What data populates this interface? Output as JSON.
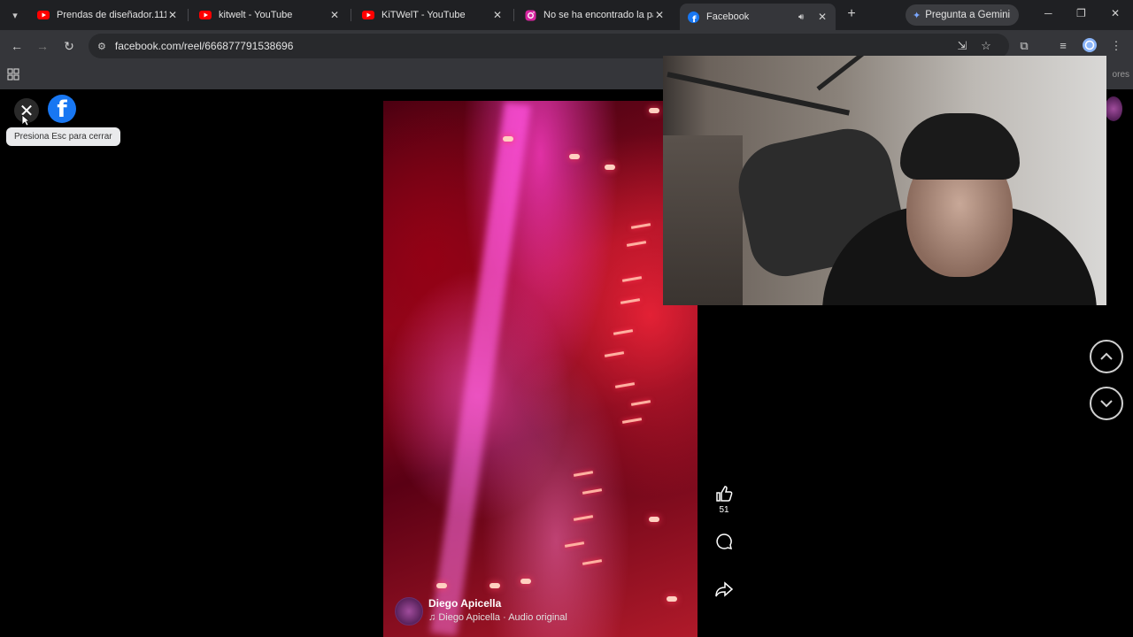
{
  "browser": {
    "tabs": [
      {
        "title": "Prendas de diseñador.1111",
        "favicon": "youtube-icon",
        "active": false
      },
      {
        "title": "kitwelt - YouTube",
        "favicon": "youtube-icon",
        "active": false
      },
      {
        "title": "KiTWelT - YouTube",
        "favicon": "youtube-icon",
        "active": false
      },
      {
        "title": "No se ha encontrado la pág",
        "favicon": "instagram-icon",
        "active": false
      },
      {
        "title": "Facebook",
        "favicon": "facebook-icon",
        "active": true
      }
    ],
    "gemini_label": "Pregunta a Gemini",
    "url": "facebook.com/reel/666877791538696",
    "bookmarks_right": "ores"
  },
  "reel": {
    "close_tooltip": "Presiona Esc para cerrar",
    "author_name": "Diego Apicella",
    "audio_label": "Diego Apicella · Audio original",
    "like_count": "51"
  },
  "colors": {
    "facebook_blue": "#1877f2",
    "tab_bar": "#1f2023",
    "toolbar": "#35363a",
    "page_bg": "#000000"
  }
}
